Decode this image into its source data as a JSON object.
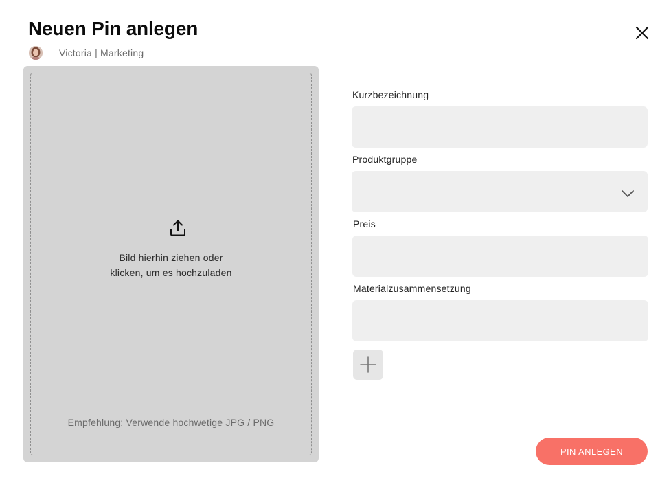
{
  "dialog": {
    "title": "Neuen Pin anlegen",
    "close_icon": "close-icon"
  },
  "user": {
    "avatar_icon": "avatar",
    "label": "Victoria | Marketing"
  },
  "upload": {
    "icon": "upload-icon",
    "line1": "Bild hierhin ziehen oder",
    "line2": "klicken, um es hochzuladen",
    "hint": "Empfehlung: Verwende hochwetige JPG / PNG"
  },
  "form": {
    "kurzbezeichnung": {
      "label": "Kurzbezeichnung",
      "value": "",
      "placeholder": ""
    },
    "produktgruppe": {
      "label": "Produktgruppe",
      "value": "",
      "icon": "chevron-down-icon"
    },
    "preis": {
      "label": "Preis",
      "value": "",
      "placeholder": ""
    },
    "material": {
      "label": "Materialzusammensetzung",
      "value": "",
      "placeholder": ""
    },
    "add_icon": "plus-icon"
  },
  "actions": {
    "submit_label": "Pin anlegen"
  },
  "colors": {
    "accent": "#f87167",
    "upload_bg": "#d4d4d4",
    "input_bg": "#efefef",
    "text_muted": "#6a6a6a"
  }
}
